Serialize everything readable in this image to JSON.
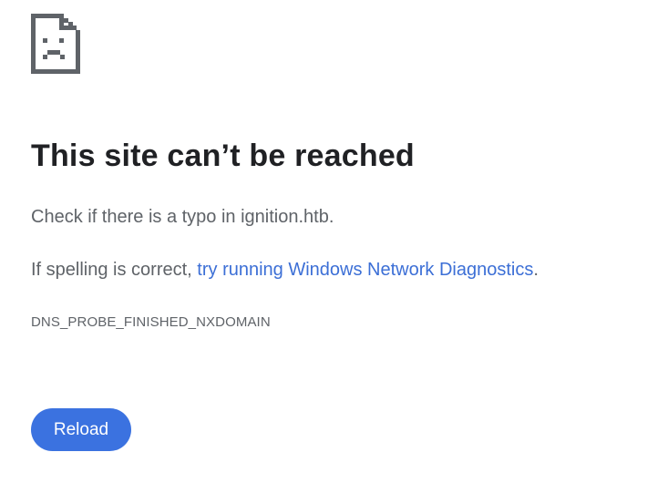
{
  "error": {
    "icon": "sad-document-icon",
    "title": "This site can’t be reached",
    "line1": "Check if there is a typo in ignition.htb.",
    "line2_prefix": "If spelling is correct, ",
    "line2_link": "try running Windows Network Diagnostics",
    "line2_suffix": ".",
    "code": "DNS_PROBE_FINISHED_NXDOMAIN"
  },
  "actions": {
    "reload_label": "Reload"
  },
  "colors": {
    "title": "#202124",
    "body_text": "#5f6368",
    "link": "#3c6fd6",
    "button_bg": "#3b72e0",
    "button_text": "#ffffff",
    "icon": "#5f6368"
  }
}
